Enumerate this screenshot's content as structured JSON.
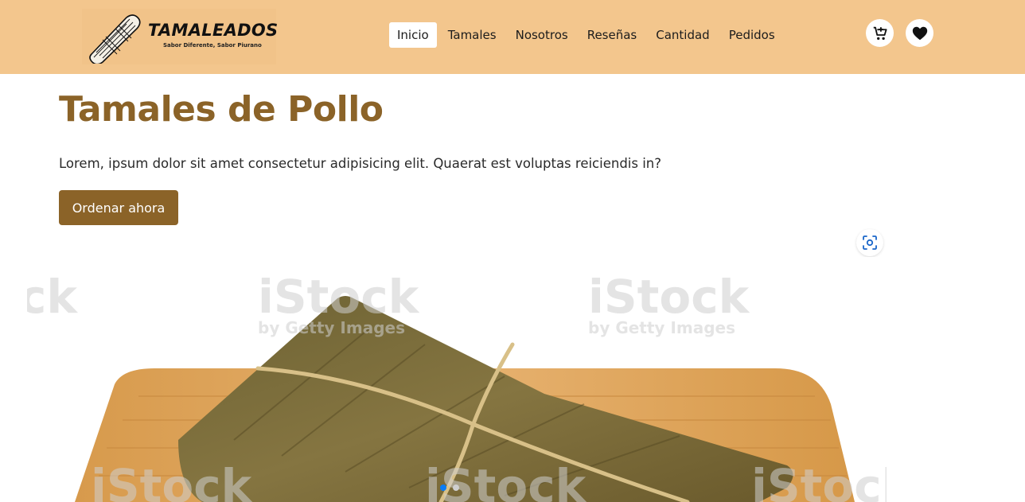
{
  "brand": {
    "name": "TAMALEADOS",
    "tagline": "Sabor Diferente, Sabor Piurano"
  },
  "nav": {
    "items": [
      {
        "label": "Inicio",
        "active": true
      },
      {
        "label": "Tamales",
        "active": false
      },
      {
        "label": "Nosotros",
        "active": false
      },
      {
        "label": "Reseñas",
        "active": false
      },
      {
        "label": "Cantidad",
        "active": false
      },
      {
        "label": "Pedidos",
        "active": false
      }
    ]
  },
  "header_actions": {
    "cart_icon": "cart-icon",
    "favorites_icon": "heart-icon"
  },
  "hero": {
    "title": "Tamales de Pollo",
    "text": "Lorem, ipsum dolor sit amet consectetur adipisicing elit. Quaerat est voluptas reiciendis in?",
    "cta": "Ordenar ahora"
  },
  "hero_image": {
    "watermark_text": "iStock",
    "watermark_subtext": "by Getty Images"
  },
  "carousel": {
    "slide_count": 2,
    "active_index": 0
  },
  "colors": {
    "header_bg": "#f3c68d",
    "accent_brown": "#8b6328",
    "carousel_active": "#0a7cf5"
  }
}
